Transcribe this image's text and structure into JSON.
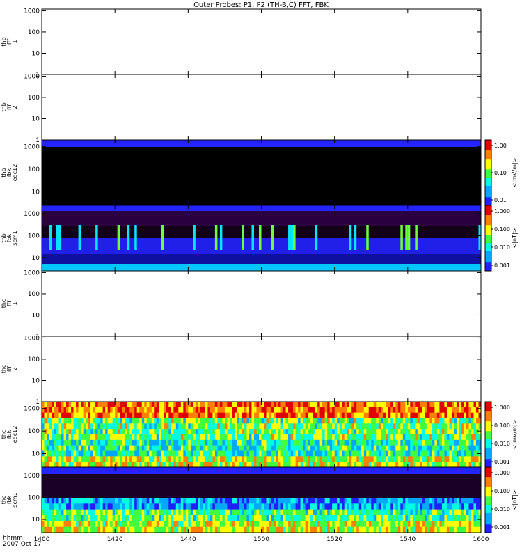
{
  "title": "Outer Probes: P1, P2 (TH-B,C) FFT, FBK",
  "time_axis": {
    "label_line1": "hhmm",
    "label_line2": "2007 Oct 17",
    "ticks": [
      "1400",
      "1420",
      "1440",
      "1500",
      "1520",
      "1540",
      "1600"
    ]
  },
  "chart_data": [
    {
      "type": "heatmap",
      "ylabel": [
        "thb",
        "fff",
        "1"
      ],
      "y_scale": "log",
      "ylim": [
        1,
        1200
      ],
      "yticks": [
        "1000",
        "100",
        "10",
        "1"
      ],
      "data": "empty",
      "colorbar": null
    },
    {
      "type": "heatmap",
      "ylabel": [
        "thb",
        "fff",
        "2"
      ],
      "y_scale": "log",
      "ylim": [
        1,
        1200
      ],
      "yticks": [
        "1000",
        "100",
        "10",
        "1"
      ],
      "data": "empty",
      "colorbar": null
    },
    {
      "type": "heatmap",
      "ylabel": [
        "thb",
        "fbk",
        "edc12"
      ],
      "y_scale": "log",
      "ylim": [
        2.5,
        2000
      ],
      "yticks": [
        "1000",
        "100",
        "10"
      ],
      "data": "mostly black (low power) with a blue band near 2048 Hz",
      "colorbar": {
        "label": "<|mV/m|>",
        "ticks": [
          "1.00",
          "0.10",
          "0.01"
        ]
      }
    },
    {
      "type": "heatmap",
      "ylabel": [
        "thb",
        "fbk",
        "scm1"
      ],
      "y_scale": "log",
      "ylim": [
        2.5,
        2400
      ],
      "yticks": [
        "1000",
        "100",
        "10"
      ],
      "data": "blue/black bands with intermittent cyan-green bursts near 30-100 Hz",
      "colorbar": {
        "label": "<|nT|>",
        "ticks": [
          "1.000",
          "0.100",
          "0.010",
          "0.001"
        ]
      }
    },
    {
      "type": "heatmap",
      "ylabel": [
        "thc",
        "fff",
        "1"
      ],
      "y_scale": "log",
      "ylim": [
        1,
        1200
      ],
      "yticks": [
        "1000",
        "100",
        "10",
        "1"
      ],
      "data": "empty",
      "colorbar": null
    },
    {
      "type": "heatmap",
      "ylabel": [
        "thc",
        "fff",
        "2"
      ],
      "y_scale": "log",
      "ylim": [
        1,
        1200
      ],
      "yticks": [
        "1000",
        "100",
        "10",
        "1"
      ],
      "data": "empty",
      "colorbar": null
    },
    {
      "type": "heatmap",
      "ylabel": [
        "thc",
        "fbk",
        "edc12"
      ],
      "y_scale": "log",
      "ylim": [
        2.5,
        2000
      ],
      "yticks": [
        "1000",
        "100",
        "10"
      ],
      "data": "broadband red/yellow/green/cyan striped spectrum",
      "colorbar": {
        "label": "<|mV/m|>",
        "ticks": [
          "1.000",
          "0.100",
          "0.010",
          "0.001"
        ]
      }
    },
    {
      "type": "heatmap",
      "ylabel": [
        "thc",
        "fbk",
        "scm1"
      ],
      "y_scale": "log",
      "ylim": [
        2.5,
        2400
      ],
      "yticks": [
        "1000",
        "100",
        "10"
      ],
      "data": "blue band at top, purple/black mid, green/cyan/yellow at low frequencies",
      "colorbar": {
        "label": "<|nT|>",
        "ticks": [
          "1.000",
          "0.100",
          "0.010",
          "0.001"
        ]
      }
    }
  ]
}
